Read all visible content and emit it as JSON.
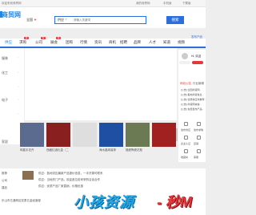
{
  "topbar": {
    "welcome": "欢迎来到商贸网",
    "links": [
      "我的商贸网",
      "手机版",
      "下载版"
    ]
  },
  "header": {
    "logo": "商贸网",
    "city": "全国",
    "city_arrow": "▼"
  },
  "search": {
    "type": "供应",
    "type_arrow": "▾",
    "placeholder": "请输入关键词",
    "button": "搜索"
  },
  "hot_link": "发布产品",
  "nav": {
    "items": [
      "供应",
      "求购",
      "公司",
      "展会",
      "团购",
      "行情",
      "资讯",
      "商机",
      "招聘",
      "品牌",
      "人才",
      "知道",
      "视频"
    ],
    "badges": [
      "热",
      "新",
      "热"
    ]
  },
  "sidebar": {
    "items": [
      "服装",
      "",
      "",
      "化工",
      "",
      "",
      "",
      "",
      "",
      "",
      "电子",
      "",
      "",
      "",
      "",
      "",
      "",
      "家居"
    ],
    "arrow": "›"
  },
  "panel": {
    "greeting": "Hi, 欢迎",
    "notice_tabs": [
      "网站公告",
      "行业新闻"
    ],
    "notices": [
      "[公告] 全国商贸网...",
      "[公告] 各地商贸信息...",
      "[公告] 优质供应商推荐...",
      "[公告] 商贸网诚信...",
      "[公告] 免费发布产品..."
    ],
    "services": [
      "发布供应",
      "发布求购",
      "企业认证",
      "店铺",
      "收藏夹",
      "客服"
    ]
  },
  "products": [
    {
      "caption": "明星手花卉",
      "color": "#5b6a8f"
    },
    {
      "caption": "西藏红酒礼盒（二",
      "color": "#8a1f1f"
    },
    {
      "caption": "",
      "color": "#dedede"
    },
    {
      "caption": "海水晶球装饰",
      "color": "#1e4fa3"
    },
    {
      "caption": "福瓷陶瓷花瓶",
      "color": "#6b7a52"
    },
    {
      "caption": "",
      "color": "#a12020"
    }
  ],
  "bottom": {
    "left": [
      "推荐",
      "公司",
      "建品"
    ],
    "rows": [
      "供应：各地供应最新产品报价信息，一手货源可联系",
      "供应：当地热门产品，欢迎各位前来采购洽谈合作",
      "供应：优质产品厂家直销，价格优惠"
    ],
    "company": "乐山市五通桥区宏泰五金经营部"
  },
  "promo": {
    "part1": "小孩资源",
    "part2": "- 秒M"
  }
}
